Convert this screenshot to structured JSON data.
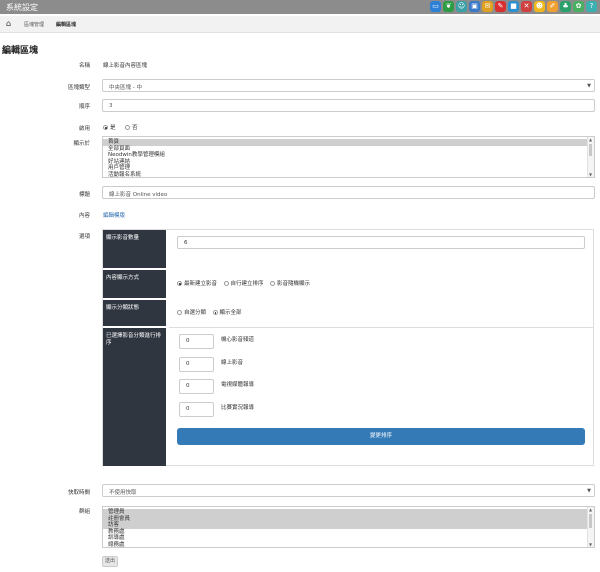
{
  "app_title": "系統設定",
  "top_icons": [
    {
      "name": "monitor-icon",
      "color": "#2e7fd6"
    },
    {
      "name": "leaf-icon",
      "color": "#2e9b45"
    },
    {
      "name": "people-icon",
      "color": "#3aa0a6"
    },
    {
      "name": "image-icon",
      "color": "#3a78c8"
    },
    {
      "name": "mail-icon",
      "color": "#e0a020"
    },
    {
      "name": "feather-icon",
      "color": "#d83030"
    },
    {
      "name": "cube-icon",
      "color": "#2b8fd0"
    },
    {
      "name": "tools-icon",
      "color": "#d04040"
    },
    {
      "name": "smiley-icon",
      "color": "#f1b81c"
    },
    {
      "name": "edit-icon",
      "color": "#f0a030"
    },
    {
      "name": "users-icon",
      "color": "#2aa06a"
    },
    {
      "name": "chat-icon",
      "color": "#48b060"
    },
    {
      "name": "help-icon",
      "color": "#3ab0b0"
    }
  ],
  "breadcrumb": {
    "home_icon": "home-icon",
    "item1": "區塊管理",
    "item2": "編輯區塊"
  },
  "page_title": "編輯區塊",
  "form": {
    "name_label": "名稱",
    "name_value": "線上影音內容區塊",
    "type_label": "區塊類型",
    "type_value": "中央區塊 - 中",
    "order_label": "順序",
    "order_value": "3",
    "enabled_label": "啟用",
    "enabled_yes": "是",
    "enabled_no": "否",
    "show_in_label": "顯示於",
    "show_in_options": [
      {
        "text": "首頁",
        "selected": true
      },
      {
        "text": "全部頁面",
        "selected": false
      },
      {
        "text": "Neodwin教學管理模組",
        "selected": false
      },
      {
        "text": "好站連結",
        "selected": false
      },
      {
        "text": "用戶管理",
        "selected": false
      },
      {
        "text": "活動報名系統",
        "selected": false
      }
    ],
    "title_label": "標題",
    "title_value": "線上影音 Online video",
    "content_label": "內容",
    "content_link": "編輯模版",
    "options_label": "選項",
    "video_count_label": "顯示影音數量",
    "video_count_value": "6",
    "display_mode_label": "內容顯示方式",
    "display_mode_options": [
      {
        "text": "最新建立影音",
        "checked": true
      },
      {
        "text": "自行建立排序",
        "checked": false
      },
      {
        "text": "影音隨機顯示",
        "checked": false
      }
    ],
    "category_status_label": "顯示分類狀態",
    "category_status_options": [
      {
        "text": "自選分類",
        "checked": false
      },
      {
        "text": "顯示全部",
        "checked": true
      }
    ],
    "selected_categories_label": "已選擇影音分類進行排序",
    "categories": [
      {
        "order": "0",
        "name": "機心影音頻道"
      },
      {
        "order": "0",
        "name": "線上影音"
      },
      {
        "order": "0",
        "name": "電視媒體報導"
      },
      {
        "order": "0",
        "name": "比賽實況報導"
      }
    ],
    "sort_button": "變更排序",
    "cache_label": "快取時間",
    "cache_value": "不使用快取",
    "groups_label": "群組",
    "groups_options": [
      {
        "text": "管理員",
        "selected": true
      },
      {
        "text": "註冊會員",
        "selected": true
      },
      {
        "text": "訪客",
        "selected": true
      },
      {
        "text": "教務處",
        "selected": false
      },
      {
        "text": "訓導處",
        "selected": false
      },
      {
        "text": "總務處",
        "selected": false
      }
    ],
    "submit_label": "送出"
  }
}
